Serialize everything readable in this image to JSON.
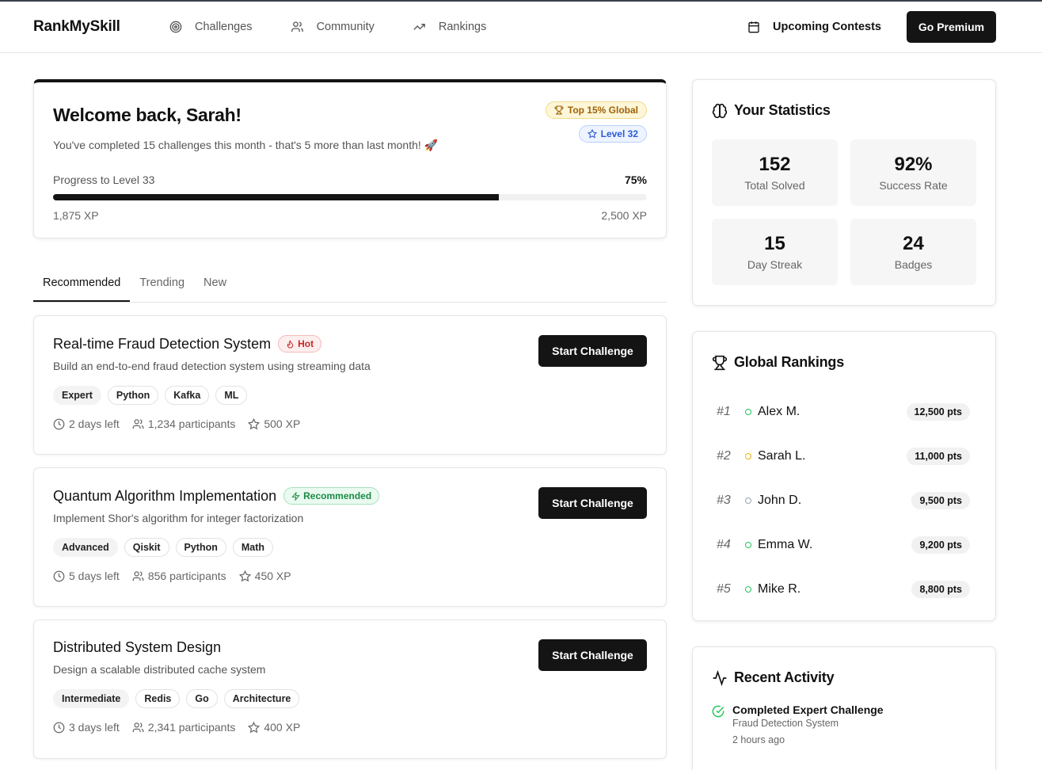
{
  "header": {
    "logo": "RankMySkill",
    "nav": [
      {
        "label": "Challenges",
        "icon": "target-icon"
      },
      {
        "label": "Community",
        "icon": "users-icon"
      },
      {
        "label": "Rankings",
        "icon": "trending-up-icon"
      }
    ],
    "contests_label": "Upcoming Contests",
    "premium_label": "Go Premium"
  },
  "welcome": {
    "title": "Welcome back, Sarah!",
    "subtitle": "You've completed 15 challenges this month - that's 5 more than last month! 🚀",
    "badge_top": "Top 15% Global",
    "badge_level": "Level 32",
    "progress_label": "Progress to Level 33",
    "progress_pct": "75%",
    "progress_value": 0.75,
    "xp_current": "1,875 XP",
    "xp_target": "2,500 XP"
  },
  "tabs": [
    "Recommended",
    "Trending",
    "New"
  ],
  "challenges": [
    {
      "title": "Real-time Fraud Detection System",
      "tag": "Hot",
      "desc": "Build an end-to-end fraud detection system using streaming data",
      "chips": [
        "Expert",
        "Python",
        "Kafka",
        "ML"
      ],
      "time": "2 days left",
      "participants": "1,234 participants",
      "xp": "500 XP",
      "button": "Start Challenge"
    },
    {
      "title": "Quantum Algorithm Implementation",
      "tag": "Recommended",
      "desc": "Implement Shor's algorithm for integer factorization",
      "chips": [
        "Advanced",
        "Qiskit",
        "Python",
        "Math"
      ],
      "time": "5 days left",
      "participants": "856 participants",
      "xp": "450 XP",
      "button": "Start Challenge"
    },
    {
      "title": "Distributed System Design",
      "tag": "",
      "desc": "Design a scalable distributed cache system",
      "chips": [
        "Intermediate",
        "Redis",
        "Go",
        "Architecture"
      ],
      "time": "3 days left",
      "participants": "2,341 participants",
      "xp": "400 XP",
      "button": "Start Challenge"
    }
  ],
  "stats": {
    "title": "Your Statistics",
    "items": [
      {
        "value": "152",
        "label": "Total Solved"
      },
      {
        "value": "92%",
        "label": "Success Rate"
      },
      {
        "value": "15",
        "label": "Day Streak"
      },
      {
        "value": "24",
        "label": "Badges"
      }
    ]
  },
  "rankings": {
    "title": "Global Rankings",
    "items": [
      {
        "pos": "#1",
        "name": "Alex M.",
        "pts": "12,500 pts",
        "color": "#22c55e"
      },
      {
        "pos": "#2",
        "name": "Sarah L.",
        "pts": "11,000 pts",
        "color": "#eab308"
      },
      {
        "pos": "#3",
        "name": "John D.",
        "pts": "9,500 pts",
        "color": "#9ca3af"
      },
      {
        "pos": "#4",
        "name": "Emma W.",
        "pts": "9,200 pts",
        "color": "#22c55e"
      },
      {
        "pos": "#5",
        "name": "Mike R.",
        "pts": "8,800 pts",
        "color": "#22c55e"
      }
    ]
  },
  "activity": {
    "title": "Recent Activity",
    "items": [
      {
        "title": "Completed Expert Challenge",
        "sub": "Fraud Detection System",
        "time": "2 hours ago"
      }
    ]
  }
}
